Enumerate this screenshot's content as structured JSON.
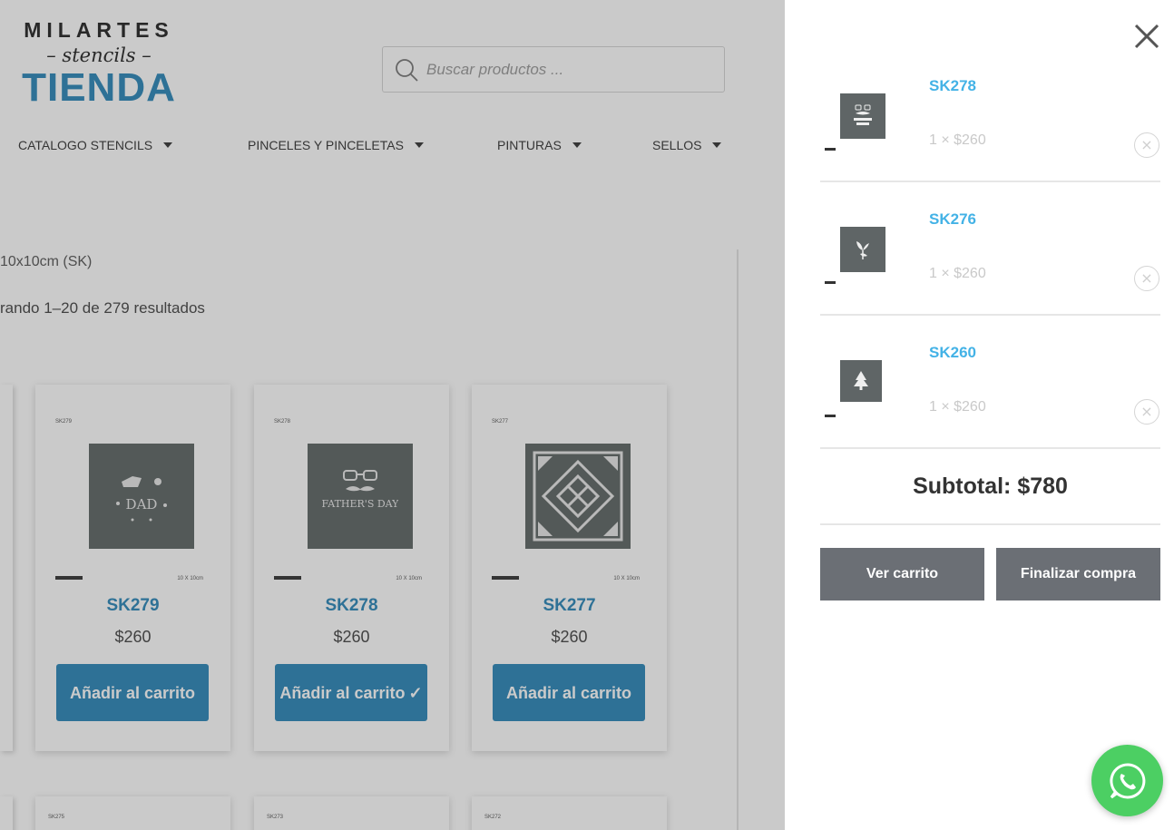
{
  "logo": {
    "line1": "MILARTES",
    "line2": "– stencils –",
    "line3": "TIENDA"
  },
  "search": {
    "placeholder": "Buscar productos ..."
  },
  "nav": [
    {
      "label": "CATALOGO STENCILS"
    },
    {
      "label": "PINCELES Y PINCELETAS"
    },
    {
      "label": "PINTURAS"
    },
    {
      "label": "SELLOS"
    }
  ],
  "breadcrumb": "10x10cm (SK)",
  "results": "rando 1–20 de 279 resultados",
  "products": [
    {
      "code": "SK279",
      "price": "$260",
      "button": "Añadir al carrito",
      "size": "10 X 10cm",
      "design": "DAD"
    },
    {
      "code": "SK278",
      "price": "$260",
      "button": "Añadir al carrito",
      "size": "10 X 10cm",
      "design": "FATHER'S DAY",
      "added": "✓"
    },
    {
      "code": "SK277",
      "price": "$260",
      "button": "Añadir al carrito",
      "size": "10 X 10cm",
      "design": ""
    }
  ],
  "next_products": [
    {
      "code": "SK275"
    },
    {
      "code": "SK273"
    },
    {
      "code": "SK272"
    }
  ],
  "cart": {
    "items": [
      {
        "name": "SK278",
        "qty": "1 × $260",
        "remove": "×"
      },
      {
        "name": "SK276",
        "qty": "1 × $260",
        "remove": "×"
      },
      {
        "name": "SK260",
        "qty": "1 × $260",
        "remove": "×"
      }
    ],
    "subtotal": "Subtotal: $780",
    "view_cart": "Ver carrito",
    "checkout": "Finalizar compra"
  },
  "colors": {
    "accent": "#2a86b8",
    "cart_link": "#43b2e6",
    "cart_button": "#6b6f75",
    "whatsapp": "#4ccf63"
  }
}
